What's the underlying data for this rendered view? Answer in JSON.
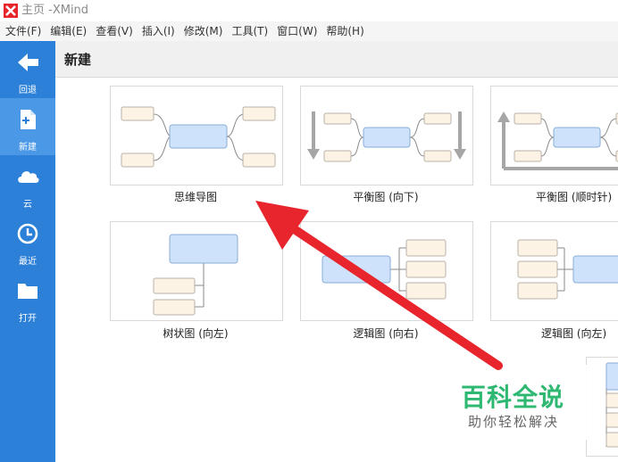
{
  "window": {
    "title": "主页 -XMind"
  },
  "menu": [
    "文件(F)",
    "编辑(E)",
    "查看(V)",
    "插入(I)",
    "修改(M)",
    "工具(T)",
    "窗口(W)",
    "帮助(H)"
  ],
  "sidebar": {
    "items": [
      {
        "label": "回退",
        "icon": "back-arrow-icon"
      },
      {
        "label": "新建",
        "icon": "new-file-icon",
        "active": true
      },
      {
        "label": "云",
        "icon": "cloud-icon"
      },
      {
        "label": "最近",
        "icon": "clock-icon"
      },
      {
        "label": "打开",
        "icon": "folder-icon"
      }
    ]
  },
  "header": {
    "title": "新建"
  },
  "templates": [
    {
      "label": "思维导图"
    },
    {
      "label": "平衡图 (向下)"
    },
    {
      "label": "平衡图 (顺时针)"
    },
    {
      "label": "树状图 (向左)"
    },
    {
      "label": "逻辑图 (向右)"
    },
    {
      "label": "逻辑图 (向左)"
    }
  ],
  "watermark": {
    "brand": "百科全说",
    "tagline": "助你轻松解决"
  },
  "colors": {
    "sidebar": "#2d80d8",
    "sidebar_active": "#4a98e6",
    "arrow": "#e8252c",
    "central_topic": "#cfe2fb",
    "sub_topic": "#fdf3e4",
    "watermark_green": "#2eb872"
  }
}
